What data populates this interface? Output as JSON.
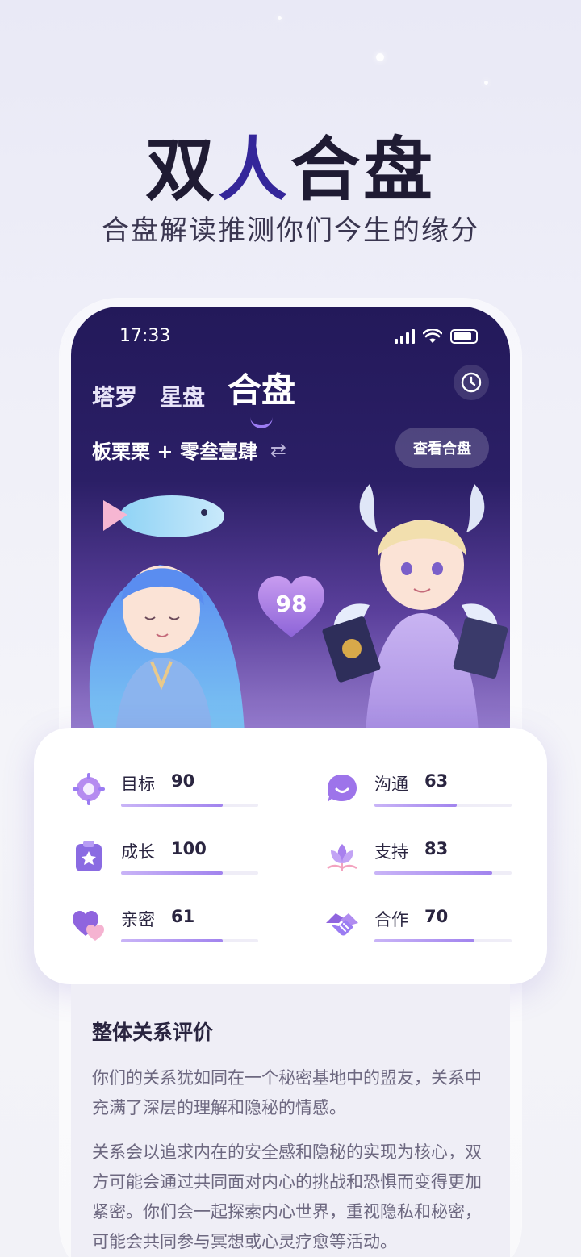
{
  "hero": {
    "title_part1": "双",
    "title_accent": "人",
    "title_part2": "合盘",
    "subtitle": "合盘解读推测你们今生的缘分"
  },
  "status_bar": {
    "time": "17:33"
  },
  "tabs": [
    {
      "label": "塔罗",
      "active": false
    },
    {
      "label": "星盘",
      "active": false
    },
    {
      "label": "合盘",
      "active": true
    }
  ],
  "pair": {
    "names": "板栗栗 + 零叁壹肆",
    "swap_icon": "swap-arrows-icon",
    "view_button": "查看合盘"
  },
  "match_score": "98",
  "stats": [
    {
      "label": "目标",
      "value": "90",
      "icon": "target-icon",
      "fill_pct": 74
    },
    {
      "label": "沟通",
      "value": "63",
      "icon": "chat-bubble-icon",
      "fill_pct": 60
    },
    {
      "label": "成长",
      "value": "100",
      "icon": "star-clipboard-icon",
      "fill_pct": 74
    },
    {
      "label": "支持",
      "value": "83",
      "icon": "lotus-icon",
      "fill_pct": 86
    },
    {
      "label": "亲密",
      "value": "61",
      "icon": "double-heart-icon",
      "fill_pct": 74
    },
    {
      "label": "合作",
      "value": "70",
      "icon": "handshake-icon",
      "fill_pct": 73
    }
  ],
  "evaluation": {
    "title": "整体关系评价",
    "paragraphs": [
      "你们的关系犹如同在一个秘密基地中的盟友，关系中充满了深层的理解和隐秘的情感。",
      "关系会以追求内在的安全感和隐秘的实现为核心，双方可能会通过共同面对内心的挑战和恐惧而变得更加紧密。你们会一起探索内心世界，重视隐私和秘密，可能会共同参与冥想或心灵疗愈等活动。"
    ]
  },
  "colors": {
    "accent": "#9b7cf2",
    "header_dark": "#23195a",
    "title_accent": "#34269a"
  }
}
